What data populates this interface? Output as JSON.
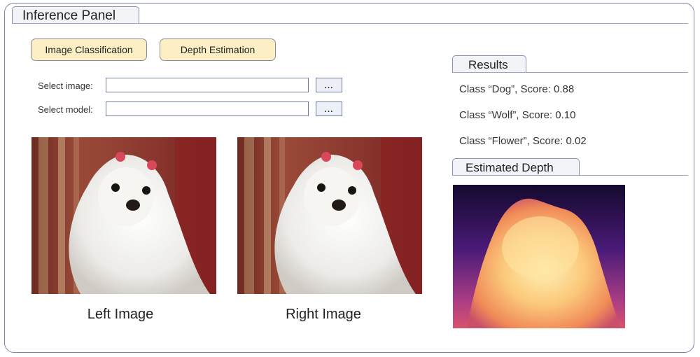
{
  "panel": {
    "title": "Inference Panel"
  },
  "buttons": {
    "classification": "Image Classification",
    "depth": "Depth Estimation"
  },
  "inputs": {
    "image": {
      "label": "Select image:",
      "value": "",
      "browse": "..."
    },
    "model": {
      "label": "Select model:",
      "value": "",
      "browse": "..."
    }
  },
  "images": {
    "left_caption": "Left Image",
    "right_caption": "Right Image"
  },
  "results": {
    "title": "Results",
    "items": [
      "Class “Dog”, Score: 0.88",
      "Class “Wolf”, Score: 0.10",
      "Class “Flower”, Score: 0.02"
    ]
  },
  "depth": {
    "title": "Estimated Depth"
  }
}
